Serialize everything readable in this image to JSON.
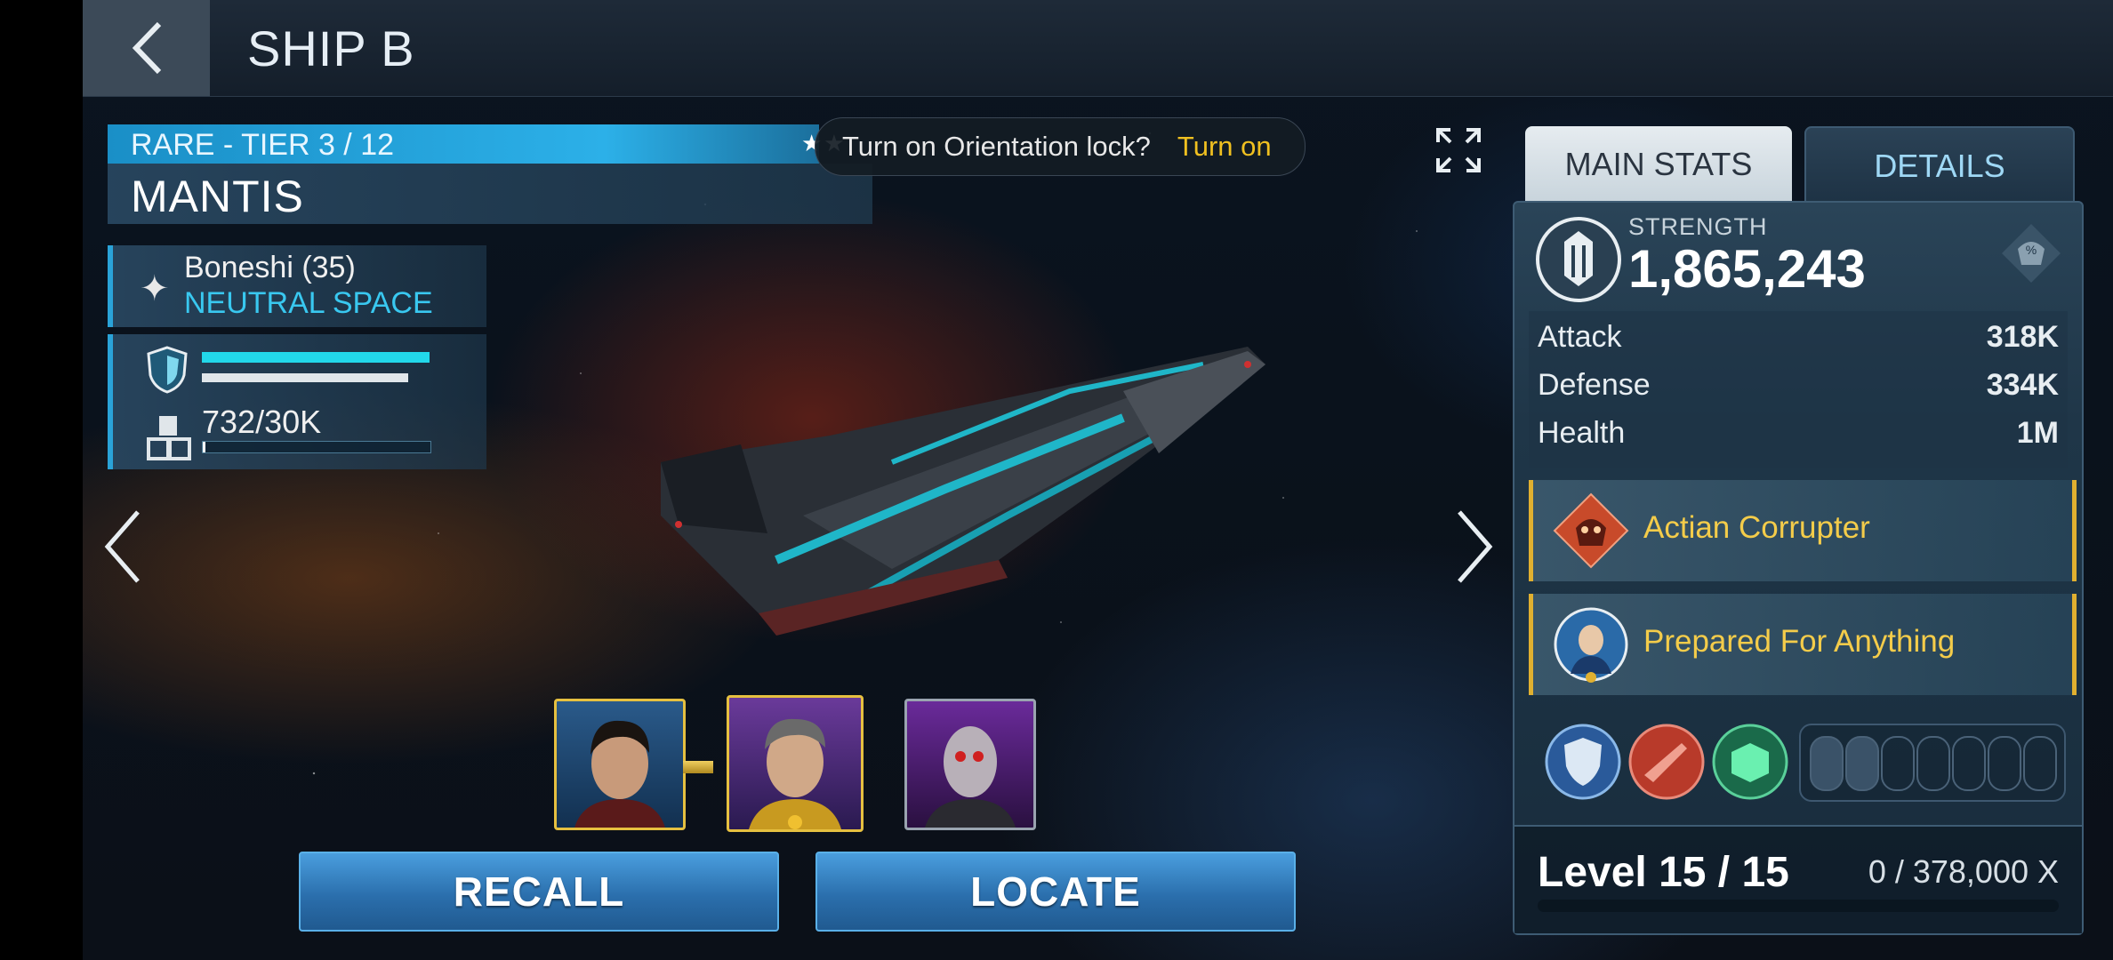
{
  "header": {
    "title": "SHIP B"
  },
  "ship": {
    "rarity_tier": "RARE  - TIER 3 / 12",
    "stars": "★★",
    "name": "MANTIS",
    "location": {
      "system": "Boneshi (35)",
      "region": "NEUTRAL SPACE"
    },
    "cargo": "732/30K"
  },
  "toast": {
    "message": "Turn on Orientation lock?",
    "action": "Turn on"
  },
  "tabs": {
    "main": "MAIN STATS",
    "details": "DETAILS"
  },
  "stats": {
    "strength_label": "STRENGTH",
    "strength_value": "1,865,243",
    "attack_label": "Attack",
    "attack_value": "318K",
    "defense_label": "Defense",
    "defense_value": "334K",
    "health_label": "Health",
    "health_value": "1M"
  },
  "abilities": [
    {
      "label": "Actian Corrupter",
      "icon": "actian-corrupter-icon"
    },
    {
      "label": "Prepared For Anything",
      "icon": "officer-ability-icon"
    }
  ],
  "level": {
    "text": "Level 15 / 15",
    "xp": "0 / 378,000 X"
  },
  "buttons": {
    "recall": "RECALL",
    "locate": "LOCATE"
  },
  "colors": {
    "accent": "#2aa3d8",
    "gold": "#f4cc4a",
    "button": "#2b6fad"
  }
}
